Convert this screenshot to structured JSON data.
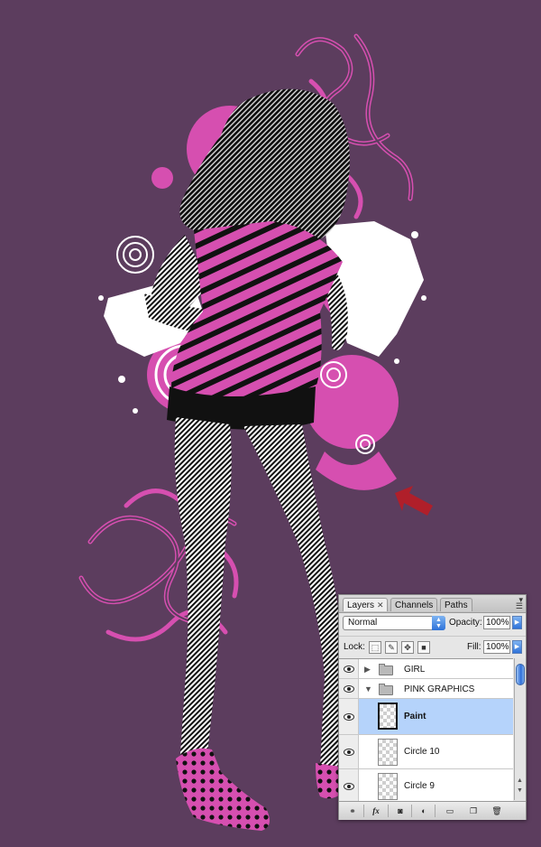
{
  "layers_panel": {
    "tabs": [
      {
        "label": "Layers",
        "active": true,
        "has_close": true
      },
      {
        "label": "Channels",
        "active": false
      },
      {
        "label": "Paths",
        "active": false
      }
    ],
    "blend_mode": "Normal",
    "opacity_label": "Opacity:",
    "opacity_value": "100%",
    "lock_label": "Lock:",
    "fill_label": "Fill:",
    "fill_value": "100%",
    "layers": [
      {
        "name": "GIRL",
        "type": "group",
        "expanded": false,
        "visible": true
      },
      {
        "name": "PINK GRAPHICS",
        "type": "group",
        "expanded": true,
        "visible": true
      },
      {
        "name": "Paint",
        "type": "layer",
        "selected": true,
        "visible": true
      },
      {
        "name": "Circle 10",
        "type": "layer",
        "selected": false,
        "visible": true
      },
      {
        "name": "Circle 9",
        "type": "layer",
        "selected": false,
        "visible": true
      }
    ],
    "bottom_buttons": [
      "link-icon",
      "fx-icon",
      "mask-icon",
      "adjustment-icon",
      "new-group-icon",
      "new-layer-icon",
      "trash-icon"
    ],
    "fx_label": "fx"
  },
  "artwork": {
    "background_color": "#5c3d5e",
    "accent_pink": "#d64fb0",
    "highlight_arrow_color": "#b01f2a"
  }
}
